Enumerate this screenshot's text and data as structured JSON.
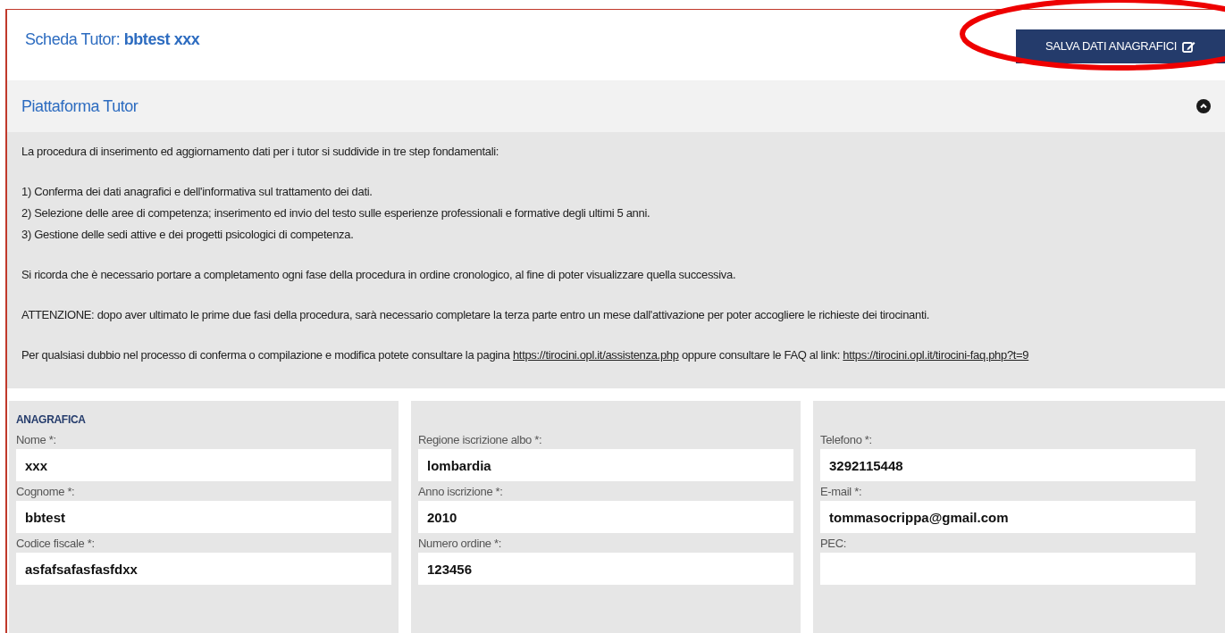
{
  "header": {
    "title_prefix": "Scheda Tutor:",
    "title_name": "bbtest xxx",
    "save_button": {
      "label": "SALVA DATI ANAGRAFICI",
      "circled": true
    }
  },
  "panel": {
    "title": "Piattaforma Tutor",
    "expanded": true,
    "paragraphs": [
      {
        "lines": [
          [
            {
              "text": "La procedura di inserimento ed aggiornamento dati per i tutor si suddivide in tre step fondamentali:"
            }
          ]
        ]
      },
      {
        "lines": [
          [
            {
              "text": "1) Conferma dei dati anagrafici e dell'informativa sul trattamento dei dati."
            }
          ],
          [
            {
              "text": "2) Selezione delle aree di competenza; inserimento ed invio del testo sulle esperienze professionali e formative degli ultimi 5 anni."
            }
          ],
          [
            {
              "text": "3) Gestione delle sedi attive e dei progetti psicologici di competenza."
            }
          ]
        ]
      },
      {
        "lines": [
          [
            {
              "text": "Si ricorda che è necessario portare a completamento ogni fase della procedura in ordine cronologico, al fine di poter visualizzare quella successiva."
            }
          ]
        ]
      },
      {
        "lines": [
          [
            {
              "text": "ATTENZIONE: dopo aver ultimato le prime due fasi della procedura, sarà necessario completare la terza parte entro un mese dall'attivazione per poter accogliere le richieste dei tirocinanti."
            }
          ]
        ]
      },
      {
        "lines": [
          [
            {
              "text": "Per qualsiasi dubbio nel processo di conferma o compilazione e modifica potete consultare la pagina "
            },
            {
              "text": "https://tirocini.opl.it/assistenza.php",
              "kind": "link"
            },
            {
              "text": " oppure consultare le FAQ al link: "
            },
            {
              "text": "https://tirocini.opl.it/tirocini-faq.php?t=9",
              "kind": "link"
            }
          ]
        ]
      }
    ]
  },
  "form": {
    "columns": [
      {
        "heading": "ANAGRAFICA",
        "fields": [
          {
            "label": "Nome *:",
            "value": "xxx"
          },
          {
            "label": "Cognome *:",
            "value": "bbtest"
          },
          {
            "label": "Codice fiscale *:",
            "value": "asfafsafasfasfdxx"
          }
        ]
      },
      {
        "fields": [
          {
            "label": "Regione iscrizione albo *:",
            "value": "lombardia"
          },
          {
            "label": "Anno iscrizione *:",
            "value": "2010"
          },
          {
            "label": "Numero ordine *:",
            "value": "123456"
          }
        ]
      },
      {
        "fields": [
          {
            "label": "Telefono *:",
            "value": "3292115448"
          },
          {
            "label": "E-mail *:",
            "value": "tommasocrippa@gmail.com"
          },
          {
            "label": "PEC:"
          }
        ]
      }
    ]
  }
}
